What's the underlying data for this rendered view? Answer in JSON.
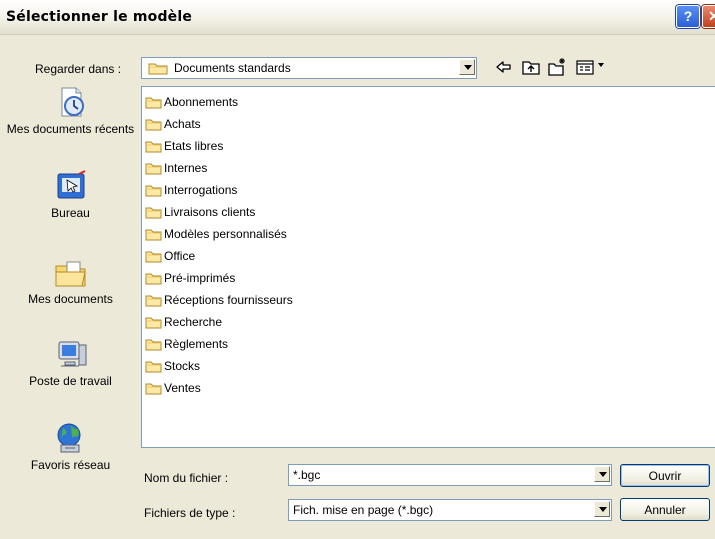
{
  "window": {
    "title": "Sélectionner le modèle",
    "help_label": "?",
    "close_label": "✕"
  },
  "lookin": {
    "label": "Regarder dans :",
    "value": "Documents standards",
    "toolbar_icons": [
      "back-arrow-icon",
      "up-folder-icon",
      "new-folder-icon",
      "view-menu-icon"
    ]
  },
  "places": [
    {
      "label": "Mes documents récents",
      "icon": "recent-documents-icon"
    },
    {
      "label": "Bureau",
      "icon": "desktop-icon"
    },
    {
      "label": "Mes documents",
      "icon": "my-documents-icon"
    },
    {
      "label": "Poste de travail",
      "icon": "my-computer-icon"
    },
    {
      "label": "Favoris réseau",
      "icon": "network-places-icon"
    }
  ],
  "folders": [
    "Abonnements",
    "Achats",
    "Etats libres",
    "Internes",
    "Interrogations",
    "Livraisons clients",
    "Modèles personnalisés",
    "Office",
    "Pré-imprimés",
    "Réceptions fournisseurs",
    "Recherche",
    "Règlements",
    "Stocks",
    "Ventes"
  ],
  "filename": {
    "label": "Nom du fichier :",
    "value": "*.bgc"
  },
  "filetype": {
    "label": "Fichiers de type :",
    "value": "Fich. mise en page (*.bgc)"
  },
  "buttons": {
    "open": "Ouvrir",
    "cancel": "Annuler"
  }
}
